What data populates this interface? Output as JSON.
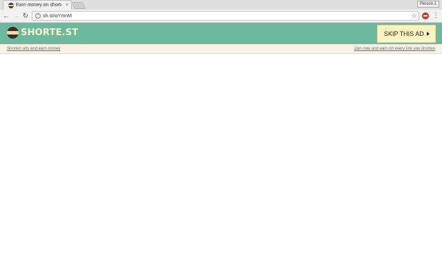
{
  "browser": {
    "tab_title": "Earn money on shorte.st",
    "tab_close": "×",
    "profile_label": "Person 1",
    "url": "sh.st/wYmnM",
    "nav": {
      "back": "←",
      "forward": "→",
      "reload": "↻",
      "info": "i",
      "star": "☆",
      "menu": "⋮"
    }
  },
  "header": {
    "logo_text": "SHORTE.ST",
    "skip_label": "SKIP THIS AD",
    "bg_color": "#6cb9a0",
    "button_color": "#fdf4c3"
  },
  "subbar": {
    "left_link": "Shorten urls and earn money",
    "right_link": "Join now and earn on every link you shorten"
  }
}
